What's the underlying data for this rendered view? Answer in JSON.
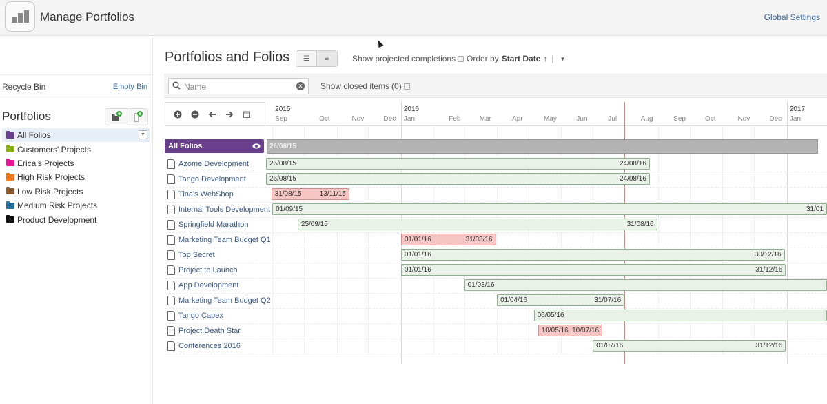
{
  "app": {
    "title": "Manage Portfolios",
    "global_settings": "Global Settings"
  },
  "sidebar": {
    "recycle_bin": "Recycle Bin",
    "empty_bin": "Empty Bin",
    "portfolios_title": "Portfolios",
    "items": [
      {
        "label": "All Folios",
        "color": "#6a3f8c",
        "selected": true
      },
      {
        "label": "Customers' Projects",
        "color": "#8db21d"
      },
      {
        "label": "Erica's Projects",
        "color": "#e8179a"
      },
      {
        "label": "High Risk Projects",
        "color": "#f07a22"
      },
      {
        "label": "Low Risk Projects",
        "color": "#8a5a32"
      },
      {
        "label": "Medium Risk Projects",
        "color": "#256f9c"
      },
      {
        "label": "Product Development",
        "color": "#111111"
      }
    ]
  },
  "main": {
    "title": "Portfolios and Folios",
    "show_projected": "Show projected completions",
    "order_by": "Order by",
    "order_field": "Start Date",
    "order_arrow": "↑",
    "order_sep": "|",
    "search_placeholder": "Name",
    "show_closed": "Show closed items",
    "closed_count": "(0)"
  },
  "timeline": {
    "years": [
      {
        "label": "2015",
        "month_index": 0
      },
      {
        "label": "2016",
        "month_index": 4
      },
      {
        "label": "2017",
        "month_index": 16
      }
    ],
    "months": [
      "Sep",
      "Oct",
      "Nov",
      "Dec",
      "Jan",
      "Feb",
      "Mar",
      "Apr",
      "May",
      "Jun",
      "Jul",
      "Aug",
      "Sep",
      "Oct",
      "Nov",
      "Dec",
      "Jan"
    ],
    "start": "2015-08-26",
    "today": "2016-07-31"
  },
  "all_folios": {
    "label": "All Folios",
    "start": "26/08/15",
    "start_iso": "2015-08-26"
  },
  "projects": [
    {
      "name": "Azome Development",
      "start": "26/08/15",
      "end": "24/08/16",
      "start_iso": "2015-08-26",
      "end_iso": "2016-08-24",
      "status": "green"
    },
    {
      "name": "Tango Development",
      "start": "26/08/15",
      "end": "24/08/16",
      "start_iso": "2015-08-26",
      "end_iso": "2016-08-24",
      "status": "green"
    },
    {
      "name": "Tina's WebShop",
      "start": "31/08/15",
      "end": "13/11/15",
      "start_iso": "2015-08-31",
      "end_iso": "2015-11-13",
      "status": "red"
    },
    {
      "name": "Internal Tools Development",
      "start": "01/09/15",
      "end": "31/01",
      "start_iso": "2015-09-01",
      "end_iso": "2017-02-10",
      "status": "green"
    },
    {
      "name": "Springfield Marathon",
      "start": "25/09/15",
      "end": "31/08/16",
      "start_iso": "2015-09-25",
      "end_iso": "2016-08-31",
      "status": "green"
    },
    {
      "name": "Marketing Team Budget Q1",
      "start": "01/01/16",
      "end": "31/03/16",
      "start_iso": "2016-01-01",
      "end_iso": "2016-03-31",
      "status": "red"
    },
    {
      "name": "Top Secret",
      "start": "01/01/16",
      "end": "30/12/16",
      "start_iso": "2016-01-01",
      "end_iso": "2016-12-30",
      "status": "green"
    },
    {
      "name": "Project to Launch",
      "start": "01/01/16",
      "end": "31/12/16",
      "start_iso": "2016-01-01",
      "end_iso": "2016-12-31",
      "status": "green"
    },
    {
      "name": "App Development",
      "start": "01/03/16",
      "end": "",
      "start_iso": "2016-03-01",
      "end_iso": "2017-02-10",
      "status": "green"
    },
    {
      "name": "Marketing Team Budget Q2",
      "start": "01/04/16",
      "end": "31/07/16",
      "start_iso": "2016-04-01",
      "end_iso": "2016-07-31",
      "status": "green"
    },
    {
      "name": "Tango Capex",
      "start": "06/05/16",
      "end": "",
      "start_iso": "2016-05-06",
      "end_iso": "2017-02-10",
      "status": "green"
    },
    {
      "name": "Project Death Star",
      "start": "10/05/16",
      "end": "10/07/16",
      "start_iso": "2016-05-10",
      "end_iso": "2016-07-10",
      "status": "red"
    },
    {
      "name": "Conferences 2016",
      "start": "01/07/16",
      "end": "31/12/16",
      "start_iso": "2016-07-01",
      "end_iso": "2016-12-31",
      "status": "green"
    }
  ]
}
